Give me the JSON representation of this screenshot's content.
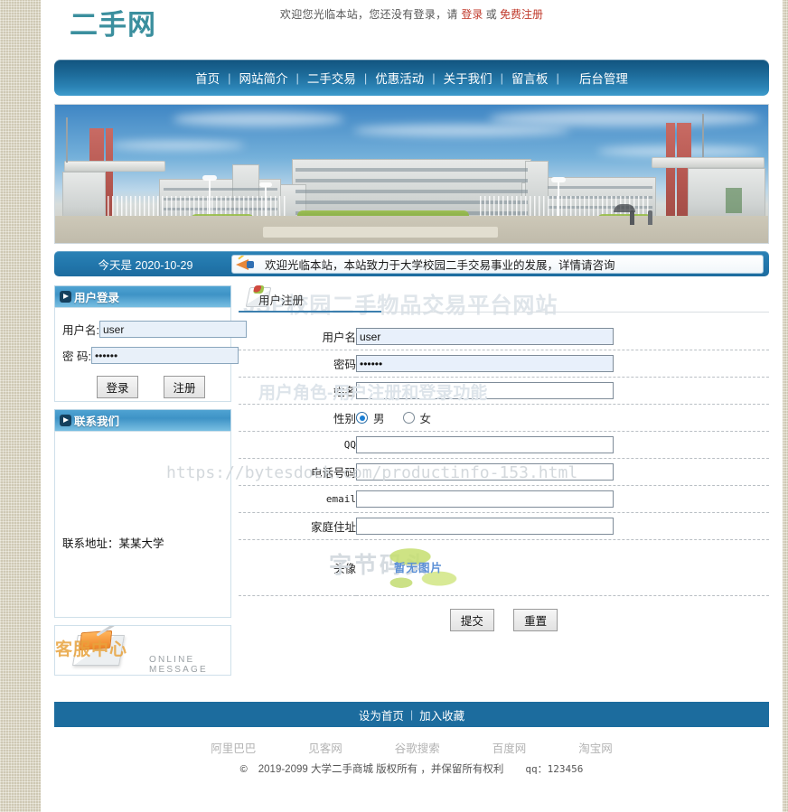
{
  "site": {
    "logo": "二手网",
    "welcome_prefix": "欢迎您光临本站，您还没有登录，请 ",
    "welcome_login": "登录",
    "welcome_or": " 或 ",
    "welcome_register": "免费注册"
  },
  "nav": {
    "items": [
      {
        "label": "首页"
      },
      {
        "label": "网站简介"
      },
      {
        "label": "二手交易"
      },
      {
        "label": "优惠活动"
      },
      {
        "label": "关于我们"
      },
      {
        "label": "留言板"
      },
      {
        "label": "后台管理"
      }
    ],
    "separator": "|"
  },
  "notice": {
    "today_label": "今天是 2020-10-29",
    "marquee_text": "欢迎光临本站，本站致力于大学校园二手交易事业的发展，详情请咨询"
  },
  "sidebar": {
    "login_panel": {
      "title": "用户登录",
      "username_label": "用户名:",
      "username_value": "user",
      "password_label": "密  码:",
      "password_value": "••••••",
      "login_button": "登录",
      "register_button": "注册"
    },
    "contact_panel": {
      "title": "联系我们",
      "address": "联系地址：某某大学"
    },
    "online_message": {
      "text": "ONLINE MESSAGE",
      "watermark": "客服中心"
    }
  },
  "main": {
    "watermark_title": "JSP校园二手物品交易平台网站",
    "watermark_sub": "用户角色-用户注册和登录功能",
    "watermark_url": "https://bytesdock.com/productinfo-153.html",
    "watermark_brand": "字节码头",
    "form_title": "用户注册",
    "fields": [
      {
        "label": "用户名",
        "value": "user",
        "filled": true,
        "type": "text"
      },
      {
        "label": "密码",
        "value": "••••••",
        "filled": true,
        "type": "password"
      },
      {
        "label": "姓名",
        "value": "",
        "filled": false,
        "type": "text"
      },
      {
        "label": "性别",
        "value": "",
        "filled": false,
        "type": "radio"
      },
      {
        "label": "QQ",
        "value": "",
        "filled": false,
        "type": "text"
      },
      {
        "label": "电话号码",
        "value": "",
        "filled": false,
        "type": "text"
      },
      {
        "label": "email",
        "value": "",
        "filled": false,
        "type": "text"
      },
      {
        "label": "家庭住址",
        "value": "",
        "filled": false,
        "type": "text"
      },
      {
        "label": "头像",
        "value": "",
        "filled": false,
        "type": "file"
      }
    ],
    "gender": {
      "male_label": "男",
      "female_label": "女",
      "selected": "男"
    },
    "avatar_placeholder": "暂无图片",
    "submit_button": "提交",
    "reset_button": "重置"
  },
  "footer": {
    "set_home": "设为首页",
    "separator": "|",
    "add_favorite": "加入收藏",
    "links": [
      {
        "label": "阿里巴巴"
      },
      {
        "label": "见客网"
      },
      {
        "label": "谷歌搜索"
      },
      {
        "label": "百度网"
      },
      {
        "label": "淘宝网"
      }
    ],
    "copyright_mark": "©",
    "copyright_text": "2019-2099  大学二手商城  版权所有 ，并保留所有权利",
    "qq": "qq：123456"
  },
  "colors": {
    "nav_blue": "#1b6795",
    "panel_blue": "#3e93c6",
    "footer_blue": "#1c6c9e",
    "logo_teal": "#3b8f9e",
    "link_red": "#c0392b",
    "page_bg": "#d9d3bd"
  }
}
